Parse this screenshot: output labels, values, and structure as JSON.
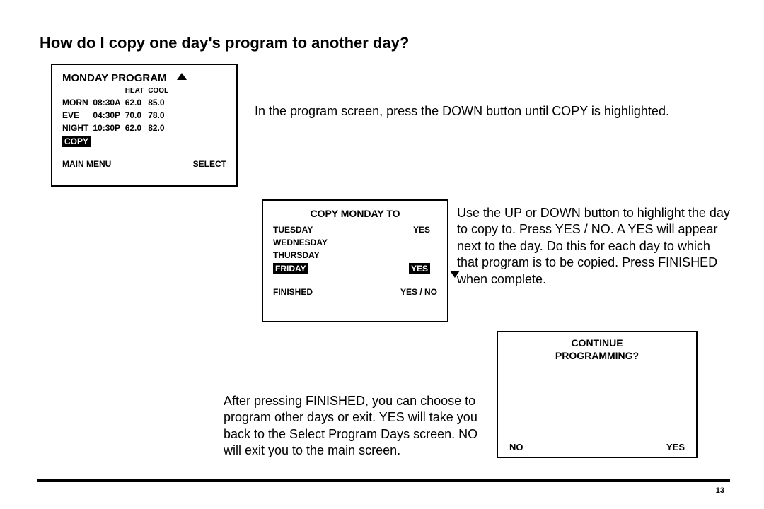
{
  "title": "How do I copy one day's program to another day?",
  "panelA": {
    "header": "MONDAY PROGRAM",
    "colHeat": "HEAT",
    "colCool": "COOL",
    "rows": [
      {
        "period": "MORN",
        "time": "08:30A",
        "heat": "62.0",
        "cool": "85.0"
      },
      {
        "period": "EVE",
        "time": "04:30P",
        "heat": "70.0",
        "cool": "78.0"
      },
      {
        "period": "NIGHT",
        "time": "10:30P",
        "heat": "62.0",
        "cool": "82.0"
      }
    ],
    "copyChip": "COPY",
    "softLeft": "MAIN MENU",
    "softRight": "SELECT"
  },
  "text1": "In the program screen, press the DOWN button until COPY is highlighted.",
  "panelB": {
    "title": "COPY MONDAY TO",
    "rows": [
      {
        "day": "TUESDAY",
        "sel": "YES",
        "hl": false
      },
      {
        "day": "WEDNESDAY",
        "sel": "",
        "hl": false
      },
      {
        "day": "THURSDAY",
        "sel": "",
        "hl": false
      },
      {
        "day": "FRIDAY",
        "sel": "YES",
        "hl": true
      }
    ],
    "footLeft": "FINISHED",
    "footRight": "YES / NO"
  },
  "text2": "Use the UP or DOWN button to highlight the day to copy to. Press YES / NO. A YES will appear next to the day. Do this for each day to which that program is to be copied. Press FINISHED when complete.",
  "text3": "After pressing FINISHED, you can choose to program other days or exit. YES will take you back to the Select Program Days screen. NO will exit you to the main screen.",
  "panelC": {
    "line1": "CONTINUE",
    "line2": "PROGRAMMING?",
    "no": "NO",
    "yes": "YES"
  },
  "pageNumber": "13"
}
